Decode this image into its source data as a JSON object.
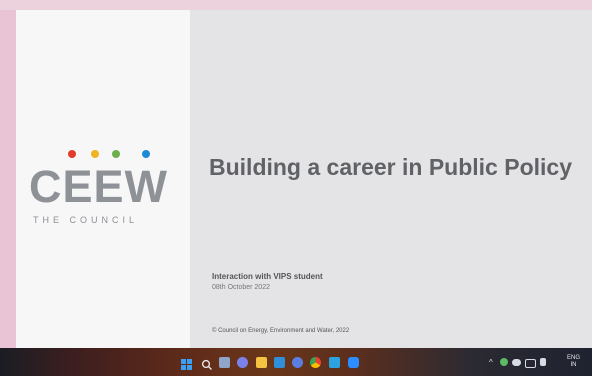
{
  "slide": {
    "logo": {
      "wordmark": "CEEW",
      "subtitle": "THE COUNCIL",
      "dot_colors": [
        "#e23c2d",
        "#f0b321",
        "#6cb04a",
        "#1e8ad6"
      ]
    },
    "title": "Building a career in Public Policy",
    "interaction": "Interaction with VIPS student",
    "date": "08th October 2022",
    "copyright": "© Council on Energy, Environment and Water, 2022"
  },
  "taskbar": {
    "icons": [
      "windows-start-icon",
      "search-icon",
      "task-view-icon",
      "chat-icon",
      "file-explorer-icon",
      "store-icon",
      "mail-icon",
      "chrome-icon",
      "edge-icon",
      "zoom-icon"
    ],
    "tray": {
      "chevron": "^",
      "language_top": "ENG",
      "language_bottom": "IN"
    }
  }
}
